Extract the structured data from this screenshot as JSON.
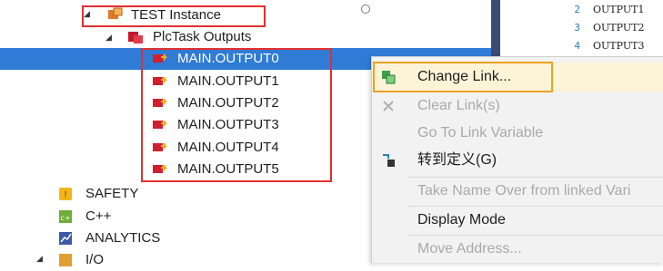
{
  "tree": {
    "instance_label": "TEST Instance",
    "outputs_folder_label": "PlcTask Outputs",
    "outputs": [
      "MAIN.OUTPUT0",
      "MAIN.OUTPUT1",
      "MAIN.OUTPUT2",
      "MAIN.OUTPUT3",
      "MAIN.OUTPUT4",
      "MAIN.OUTPUT5"
    ],
    "selected_index": 0,
    "nodes": [
      {
        "label": "SAFETY",
        "icon": "safety-icon"
      },
      {
        "label": "C++",
        "icon": "cpp-icon"
      },
      {
        "label": "ANALYTICS",
        "icon": "analytics-icon"
      },
      {
        "label": "I/O",
        "icon": "io-icon"
      }
    ]
  },
  "code": {
    "lines": [
      {
        "num": "2",
        "text": "OUTPUT1"
      },
      {
        "num": "3",
        "text": "OUTPUT2"
      },
      {
        "num": "4",
        "text": "OUTPUT3"
      }
    ]
  },
  "context_menu": {
    "items": [
      {
        "label": "Change Link...",
        "enabled": true,
        "icon": "change-link-icon",
        "highlighted": true
      },
      {
        "label": "Clear Link(s)",
        "enabled": false,
        "icon": "clear-link-icon"
      },
      {
        "label": "Go To Link Variable",
        "enabled": false,
        "icon": ""
      },
      {
        "label": "转到定义(G)",
        "enabled": true,
        "icon": "go-to-definition-icon"
      },
      {
        "label": "Take Name Over from linked Vari",
        "enabled": false,
        "icon": ""
      },
      {
        "label": "Display Mode",
        "enabled": true,
        "icon": ""
      },
      {
        "label": "Move Address...",
        "enabled": false,
        "icon": ""
      }
    ]
  },
  "colors": {
    "selection": "#2f7bd6",
    "annotation_red": "#e03030",
    "annotation_orange": "#f0a020",
    "menu_background": "#f2f2f2"
  }
}
